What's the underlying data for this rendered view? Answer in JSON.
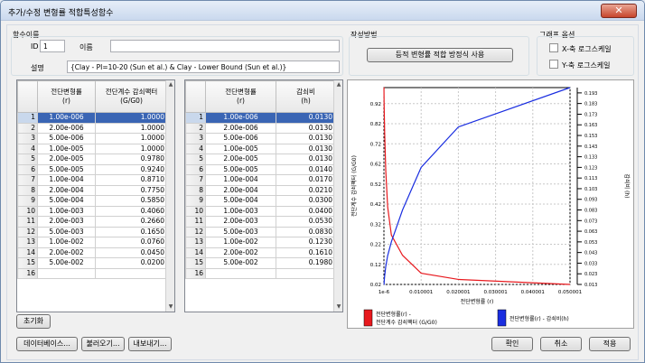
{
  "window": {
    "title": "추가/수정 변형률 적합특성함수",
    "close_glyph": "✕"
  },
  "function_name": {
    "group_label": "함수이름",
    "id_label": "ID",
    "id_value": "1",
    "name_label": "이름",
    "name_value": "",
    "desc_label": "설명",
    "desc_value": "{Clay - PI=10-20 (Sun et al.) & Clay - Lower Bound (Sun et al.)}"
  },
  "method": {
    "group_label": "작성방법",
    "button_label": "등적 변형률 적합 방정식 사용"
  },
  "graph_options": {
    "group_label": "그래프 옵션",
    "x_log_label": "X-축 로그스케일",
    "y_log_label": "Y-축 로그스케일"
  },
  "table_left": {
    "col1_line1": "전단변형률",
    "col1_line2": "(r)",
    "col2_line1": "전단계수 감쇠팩터",
    "col2_line2": "(G/G0)",
    "rows": [
      {
        "n": "1",
        "a": "1.00e-006",
        "b": "1.0000"
      },
      {
        "n": "2",
        "a": "2.00e-006",
        "b": "1.0000"
      },
      {
        "n": "3",
        "a": "5.00e-006",
        "b": "1.0000"
      },
      {
        "n": "4",
        "a": "1.00e-005",
        "b": "1.0000"
      },
      {
        "n": "5",
        "a": "2.00e-005",
        "b": "0.9780"
      },
      {
        "n": "6",
        "a": "5.00e-005",
        "b": "0.9240"
      },
      {
        "n": "7",
        "a": "1.00e-004",
        "b": "0.8710"
      },
      {
        "n": "8",
        "a": "2.00e-004",
        "b": "0.7750"
      },
      {
        "n": "9",
        "a": "5.00e-004",
        "b": "0.5850"
      },
      {
        "n": "10",
        "a": "1.00e-003",
        "b": "0.4060"
      },
      {
        "n": "11",
        "a": "2.00e-003",
        "b": "0.2660"
      },
      {
        "n": "12",
        "a": "5.00e-003",
        "b": "0.1650"
      },
      {
        "n": "13",
        "a": "1.00e-002",
        "b": "0.0760"
      },
      {
        "n": "14",
        "a": "2.00e-002",
        "b": "0.0450"
      },
      {
        "n": "15",
        "a": "5.00e-002",
        "b": "0.0200"
      },
      {
        "n": "16",
        "a": "",
        "b": ""
      }
    ]
  },
  "table_right": {
    "col1_line1": "전단변형률",
    "col1_line2": "(r)",
    "col2_line1": "감쇠비",
    "col2_line2": "(h)",
    "rows": [
      {
        "n": "1",
        "a": "1.00e-006",
        "b": "0.0130"
      },
      {
        "n": "2",
        "a": "2.00e-006",
        "b": "0.0130"
      },
      {
        "n": "3",
        "a": "5.00e-006",
        "b": "0.0130"
      },
      {
        "n": "4",
        "a": "1.00e-005",
        "b": "0.0130"
      },
      {
        "n": "5",
        "a": "2.00e-005",
        "b": "0.0130"
      },
      {
        "n": "6",
        "a": "5.00e-005",
        "b": "0.0140"
      },
      {
        "n": "7",
        "a": "1.00e-004",
        "b": "0.0170"
      },
      {
        "n": "8",
        "a": "2.00e-004",
        "b": "0.0210"
      },
      {
        "n": "9",
        "a": "5.00e-004",
        "b": "0.0300"
      },
      {
        "n": "10",
        "a": "1.00e-003",
        "b": "0.0400"
      },
      {
        "n": "11",
        "a": "2.00e-003",
        "b": "0.0530"
      },
      {
        "n": "12",
        "a": "5.00e-003",
        "b": "0.0830"
      },
      {
        "n": "13",
        "a": "1.00e-002",
        "b": "0.1230"
      },
      {
        "n": "14",
        "a": "2.00e-002",
        "b": "0.1610"
      },
      {
        "n": "15",
        "a": "5.00e-002",
        "b": "0.1980"
      },
      {
        "n": "16",
        "a": "",
        "b": ""
      }
    ]
  },
  "buttons": {
    "reset": "초기화",
    "database": "데이터베이스...",
    "import": "불러오기...",
    "export": "내보내기...",
    "ok": "확인",
    "cancel": "취소",
    "apply": "적용"
  },
  "chart_data": {
    "type": "line",
    "xlabel": "전단변형률 (r)",
    "ylabel_left": "전단계수 감쇠팩터 (G/G0)",
    "ylabel_right": "감쇠비 (h)",
    "x_ticks": [
      "1e-6",
      "0.010001",
      "0.020001",
      "0.030001",
      "0.040001",
      "0.050001"
    ],
    "x_tick_values": [
      1e-06,
      0.010001,
      0.020001,
      0.030001,
      0.040001,
      0.050001
    ],
    "xlim": [
      1e-06,
      0.050001
    ],
    "y_left_ticks": [
      "0.02",
      "0.12",
      "0.22",
      "0.32",
      "0.42",
      "0.52",
      "0.62",
      "0.72",
      "0.82",
      "0.92"
    ],
    "y_left_lim": [
      0.02,
      1.0
    ],
    "y_right_ticks": [
      "0.013",
      "0.023",
      "0.033",
      "0.043",
      "0.053",
      "0.063",
      "0.073",
      "0.083",
      "0.093",
      "0.103",
      "0.113",
      "0.123",
      "0.133",
      "0.143",
      "0.153",
      "0.163",
      "0.173",
      "0.183",
      "0.193"
    ],
    "y_right_lim": [
      0.013,
      0.198
    ],
    "series": [
      {
        "name": "전단변형률(r) - 전단계수 감쇠팩터 (G/G0)",
        "axis": "left",
        "color": "#e8191e",
        "x": [
          1e-06,
          2e-06,
          5e-06,
          1e-05,
          2e-05,
          5e-05,
          0.0001,
          0.0002,
          0.0005,
          0.001,
          0.002,
          0.005,
          0.01,
          0.02,
          0.05
        ],
        "y": [
          1.0,
          1.0,
          1.0,
          1.0,
          0.978,
          0.924,
          0.871,
          0.775,
          0.585,
          0.406,
          0.266,
          0.165,
          0.076,
          0.045,
          0.02
        ]
      },
      {
        "name": "전단변형률(r) - 감쇠비(h)",
        "axis": "right",
        "color": "#1a2ee0",
        "x": [
          1e-06,
          2e-06,
          5e-06,
          1e-05,
          2e-05,
          5e-05,
          0.0001,
          0.0002,
          0.0005,
          0.001,
          0.002,
          0.005,
          0.01,
          0.02,
          0.05
        ],
        "y": [
          0.013,
          0.013,
          0.013,
          0.013,
          0.013,
          0.014,
          0.017,
          0.021,
          0.03,
          0.04,
          0.053,
          0.083,
          0.123,
          0.161,
          0.198
        ]
      }
    ],
    "legend": [
      {
        "line1": "전단변형률(r) -",
        "line2": "전단계수 감쇠팩터 (G/G0)",
        "color": "#e8191e"
      },
      {
        "line1": "전단변형률(r) - 감쇠비(h)",
        "line2": "",
        "color": "#1a2ee0"
      }
    ]
  }
}
